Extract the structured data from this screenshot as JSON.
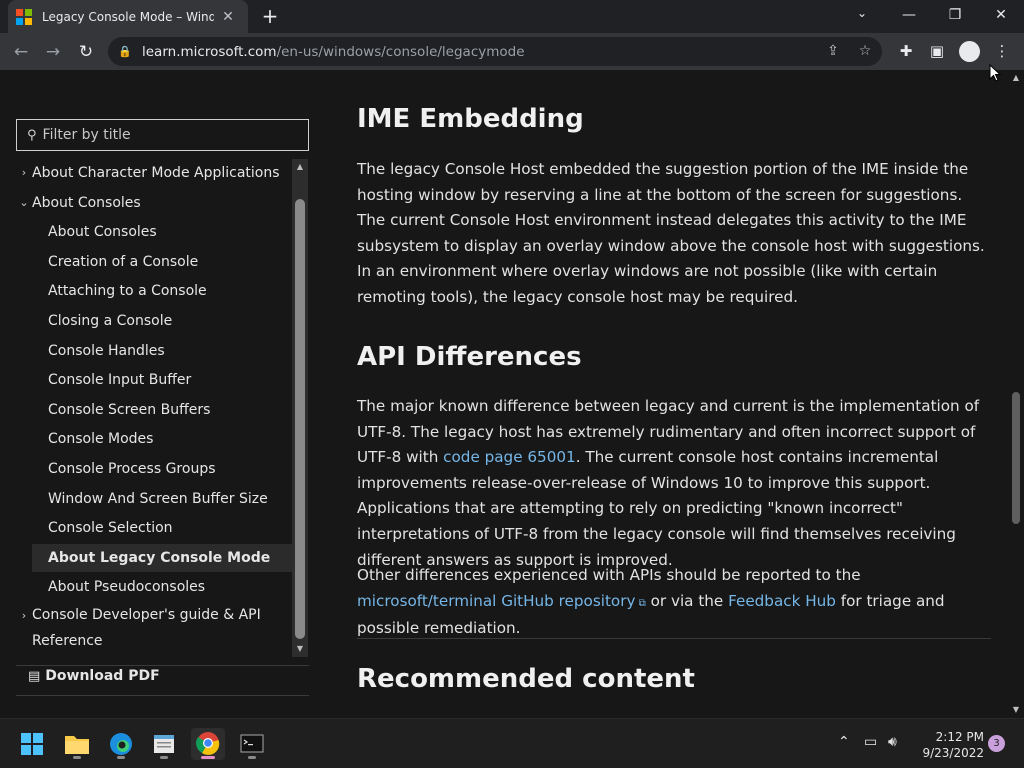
{
  "browser": {
    "tab_title": "Legacy Console Mode – Windows",
    "tab_close": "✕",
    "new_tab": "+",
    "url_host": "learn.microsoft.com",
    "url_path": "/en-us/windows/console/legacymode",
    "icons": [
      "back-icon",
      "forward-icon",
      "reload-icon",
      "lock-icon",
      "share-icon",
      "star-icon",
      "extensions-icon",
      "side-panel-icon",
      "profile-icon",
      "menu-icon"
    ],
    "window_controls": {
      "minimize": "—",
      "restore": "❐",
      "close": "✕"
    }
  },
  "sidebar": {
    "filter_placeholder": "Filter by title",
    "items": [
      {
        "label": "About Character Mode Applications",
        "level": 1,
        "chevron": "›"
      },
      {
        "label": "About Consoles",
        "level": 1,
        "chevron": "⌄"
      },
      {
        "label": "About Consoles",
        "level": 2
      },
      {
        "label": "Creation of a Console",
        "level": 2
      },
      {
        "label": "Attaching to a Console",
        "level": 2
      },
      {
        "label": "Closing a Console",
        "level": 2
      },
      {
        "label": "Console Handles",
        "level": 2
      },
      {
        "label": "Console Input Buffer",
        "level": 2
      },
      {
        "label": "Console Screen Buffers",
        "level": 2
      },
      {
        "label": "Console Modes",
        "level": 2
      },
      {
        "label": "Console Process Groups",
        "level": 2
      },
      {
        "label": "Window And Screen Buffer Size",
        "level": 2
      },
      {
        "label": "Console Selection",
        "level": 2
      },
      {
        "label": "About Legacy Console Mode",
        "level": 2,
        "active": true
      },
      {
        "label": "About Pseudoconsoles",
        "level": 2
      },
      {
        "label": "Console Developer's guide & API Reference",
        "level": 1,
        "chevron": "›"
      }
    ],
    "download_label": "Download PDF"
  },
  "article": {
    "h_ime": "IME Embedding",
    "p_ime": "The legacy Console Host embedded the suggestion portion of the IME inside the hosting window by reserving a line at the bottom of the screen for suggestions. The current Console Host environment instead delegates this activity to the IME subsystem to display an overlay window above the console host with suggestions. In an environment where overlay windows are not possible (like with certain remoting tools), the legacy console host may be required.",
    "h_api": "API Differences",
    "p_api_1": "The major known difference between legacy and current is the implementation of UTF-8. The legacy host has extremely rudimentary and often incorrect support of UTF-8 with ",
    "link_codepage": "code page 65001",
    "p_api_2": ". The current console host contains incremental improvements release-over-release of Windows 10 to improve this support. Applications that are attempting to rely on predicting \"known incorrect\" interpretations of UTF-8 from the legacy console will find themselves receiving different answers as support is improved.",
    "p_other_1": "Other differences experienced with APIs should be reported to the ",
    "link_repo": "microsoft/terminal GitHub repository",
    "p_other_2": " or via the ",
    "link_feedback": "Feedback Hub",
    "p_other_3": " for triage and possible remediation.",
    "h_recommended": "Recommended content"
  },
  "taskbar": {
    "apps": [
      "start-icon",
      "file-explorer-icon",
      "edge-icon",
      "notepad-icon",
      "chrome-icon",
      "terminal-icon"
    ],
    "time": "2:12 PM",
    "date": "9/23/2022",
    "notification_count": "3"
  },
  "colors": {
    "link": "#75b6e7",
    "bg": "#171717",
    "chrome_dark": "#202124",
    "chrome_mid": "#35363a"
  }
}
